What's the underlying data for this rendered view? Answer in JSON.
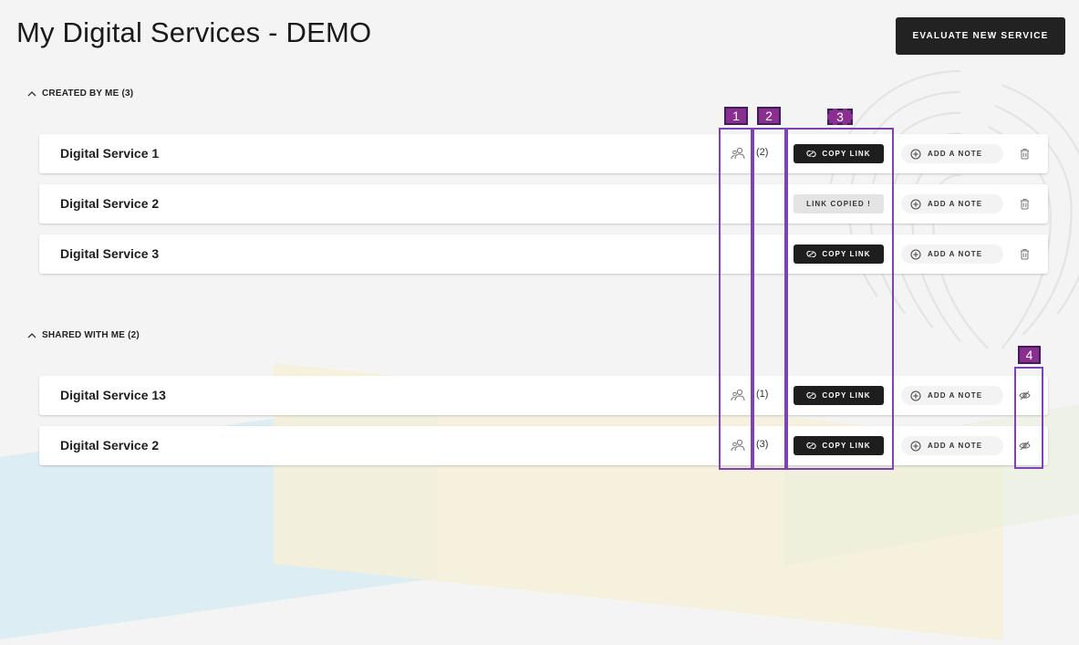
{
  "page": {
    "title": "My Digital Services - DEMO",
    "evaluate_button": "EVALUATE NEW SERVICE"
  },
  "sections": [
    {
      "header": "CREATED BY ME (3)",
      "rows": [
        {
          "name": "Digital Service 1",
          "users": "(2)",
          "link_label": "COPY LINK",
          "note_label": "ADD A NOTE",
          "action": "trash-icon"
        },
        {
          "name": "Digital Service 2",
          "users": "",
          "link_label": "LINK COPIED !",
          "note_label": "ADD A NOTE",
          "action": "trash-icon"
        },
        {
          "name": "Digital Service 3",
          "users": "",
          "link_label": "COPY LINK",
          "note_label": "ADD A NOTE",
          "action": "trash-icon"
        }
      ]
    },
    {
      "header": "SHARED WITH ME (2)",
      "rows": [
        {
          "name": "Digital Service 13",
          "users": "(1)",
          "link_label": "COPY LINK",
          "note_label": "ADD A NOTE",
          "action": "eye-off-icon"
        },
        {
          "name": "Digital Service 2",
          "users": "(3)",
          "link_label": "COPY LINK",
          "note_label": "ADD A NOTE",
          "action": "eye-off-icon"
        }
      ]
    }
  ],
  "annotations": [
    "1",
    "2",
    "3",
    "4"
  ],
  "colors": {
    "button_dark": "#1e1e1e",
    "copied_bg": "#e4e4e4",
    "annotation_border": "#7d42b5",
    "annotation_label": "#8b2d91"
  }
}
